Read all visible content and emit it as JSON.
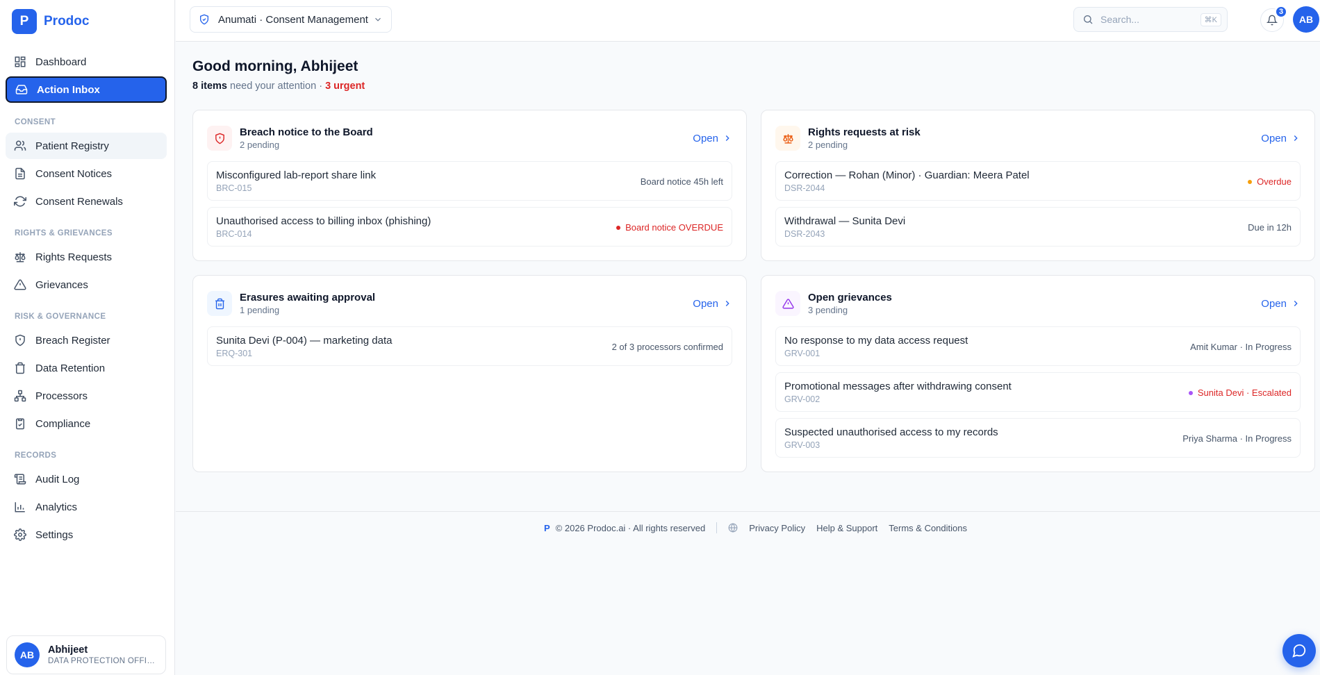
{
  "brand": {
    "logo_letter": "P",
    "name": "Prodoc"
  },
  "sidebar": {
    "top_items": [
      {
        "label": "Dashboard",
        "icon": "dashboard-icon"
      },
      {
        "label": "Action Inbox",
        "icon": "inbox-icon",
        "active": true
      }
    ],
    "sections": [
      {
        "title": "CONSENT",
        "items": [
          {
            "label": "Patient Registry",
            "icon": "users-icon"
          },
          {
            "label": "Consent Notices",
            "icon": "document-icon"
          },
          {
            "label": "Consent Renewals",
            "icon": "refresh-icon"
          }
        ]
      },
      {
        "title": "RIGHTS & GRIEVANCES",
        "items": [
          {
            "label": "Rights Requests",
            "icon": "scale-icon"
          },
          {
            "label": "Grievances",
            "icon": "warning-icon"
          }
        ]
      },
      {
        "title": "RISK & GOVERNANCE",
        "items": [
          {
            "label": "Breach Register",
            "icon": "shield-icon"
          },
          {
            "label": "Data Retention",
            "icon": "trash-icon"
          },
          {
            "label": "Processors",
            "icon": "network-icon"
          },
          {
            "label": "Compliance",
            "icon": "clipboard-check-icon"
          }
        ]
      },
      {
        "title": "RECORDS",
        "items": [
          {
            "label": "Audit Log",
            "icon": "scroll-icon"
          },
          {
            "label": "Analytics",
            "icon": "bar-chart-icon"
          },
          {
            "label": "Settings",
            "icon": "gear-icon"
          }
        ]
      }
    ],
    "user": {
      "initials": "AB",
      "name": "Abhijeet",
      "role": "DATA PROTECTION OFFICER"
    }
  },
  "header": {
    "workspace": "Anumati · Consent Management",
    "search_placeholder": "Search...",
    "search_shortcut": "⌘K",
    "notifications_count": "3",
    "avatar_initials": "AB"
  },
  "main": {
    "greeting": "Good morning, Abhijeet",
    "summary_count": "8 items",
    "summary_text": " need your attention · ",
    "summary_urgent": "3 urgent",
    "cards": [
      {
        "title": "Breach notice to the Board",
        "count": "2 pending",
        "open_label": "Open",
        "icon": "shield-alert-icon",
        "color": "#dc2626",
        "items": [
          {
            "title": "Misconfigured lab-report share link",
            "id": "BRC-015",
            "meta": "Board notice 45h left",
            "status": "normal"
          },
          {
            "title": "Unauthorised access to billing inbox (phishing)",
            "id": "BRC-014",
            "meta": "Board notice OVERDUE",
            "status": "overdue"
          }
        ]
      },
      {
        "title": "Rights requests at risk",
        "count": "2 pending",
        "open_label": "Open",
        "icon": "scale-icon",
        "color": "#ea580c",
        "items": [
          {
            "title": "Correction — Rohan (Minor) · Guardian: Meera Patel",
            "id": "DSR-2044",
            "meta": "Overdue",
            "status": "overdue-amber"
          },
          {
            "title": "Withdrawal — Sunita Devi",
            "id": "DSR-2043",
            "meta": "Due in 12h",
            "status": "normal"
          }
        ]
      },
      {
        "title": "Erasures awaiting approval",
        "count": "1 pending",
        "open_label": "Open",
        "icon": "trash-icon",
        "color": "#2563eb",
        "items": [
          {
            "title": "Sunita Devi (P-004) — marketing data",
            "id": "ERQ-301",
            "meta": "2 of 3 processors confirmed",
            "status": "normal"
          }
        ]
      },
      {
        "title": "Open grievances",
        "count": "3 pending",
        "open_label": "Open",
        "icon": "warning-icon",
        "color": "#9333ea",
        "items": [
          {
            "title": "No response to my data access request",
            "id": "GRV-001",
            "meta": "Amit Kumar · In Progress",
            "status": "normal"
          },
          {
            "title": "Promotional messages after withdrawing consent",
            "id": "GRV-002",
            "meta": "Sunita Devi · Escalated",
            "status": "escalated"
          },
          {
            "title": "Suspected unauthorised access to my records",
            "id": "GRV-003",
            "meta": "Priya Sharma · In Progress",
            "status": "normal"
          }
        ]
      }
    ]
  },
  "footer": {
    "logo_letter": "P",
    "copyright": "© 2026 Prodoc.ai · All rights reserved",
    "links": [
      "Privacy Policy",
      "Help & Support",
      "Terms & Conditions"
    ]
  }
}
